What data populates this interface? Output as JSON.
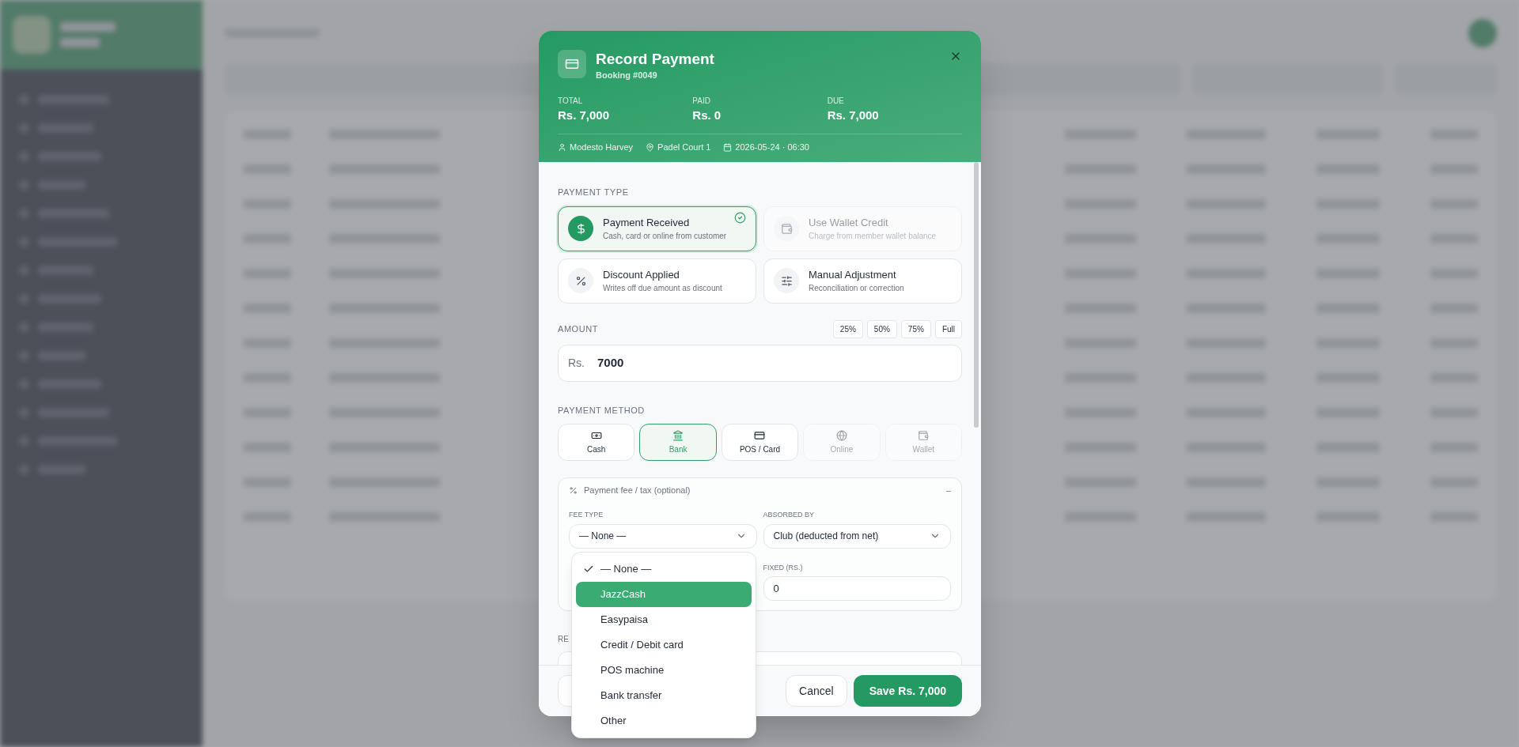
{
  "modal": {
    "title": "Record Payment",
    "subtitle": "Booking #0049",
    "summary": [
      {
        "label": "TOTAL",
        "value": "Rs. 7,000"
      },
      {
        "label": "PAID",
        "value": "Rs. 0"
      },
      {
        "label": "DUE",
        "value": "Rs. 7,000"
      }
    ],
    "meta": [
      {
        "kind": "person",
        "text": "Modesto Harvey"
      },
      {
        "kind": "location",
        "text": "Padel Court 1"
      },
      {
        "kind": "date",
        "text": "2026-05-24 · 06:30"
      }
    ]
  },
  "payment_type": {
    "label": "PAYMENT TYPE",
    "options": [
      {
        "kind": "received",
        "title": "Payment Received",
        "description": "Cash, card or online from customer",
        "selected": true,
        "disabled": false
      },
      {
        "kind": "wallet",
        "title": "Use Wallet Credit",
        "description": "Charge from member wallet balance",
        "selected": false,
        "disabled": true
      },
      {
        "kind": "discount",
        "title": "Discount Applied",
        "description": "Writes off due amount as discount",
        "selected": false,
        "disabled": false
      },
      {
        "kind": "adjustment",
        "title": "Manual Adjustment",
        "description": "Reconciliation or correction",
        "selected": false,
        "disabled": false
      }
    ]
  },
  "amount": {
    "label": "AMOUNT",
    "quick": [
      "25%",
      "50%",
      "75%",
      "Full"
    ],
    "currency": "Rs.",
    "value": "7000"
  },
  "payment_method": {
    "label": "PAYMENT METHOD",
    "options": [
      {
        "kind": "cash",
        "label": "Cash",
        "selected": false,
        "disabled": false
      },
      {
        "kind": "bank",
        "label": "Bank",
        "selected": true,
        "disabled": false
      },
      {
        "kind": "card",
        "label": "POS / Card",
        "selected": false,
        "disabled": false
      },
      {
        "kind": "online",
        "label": "Online",
        "selected": false,
        "disabled": true
      },
      {
        "kind": "wallet",
        "label": "Wallet",
        "selected": false,
        "disabled": true
      }
    ]
  },
  "fee": {
    "title": "Payment fee / tax (optional)",
    "toggle": "–",
    "fee_type": {
      "label": "FEE TYPE",
      "value": "— None —"
    },
    "absorbed_by": {
      "label": "ABSORBED BY",
      "value": "Club (deducted from net)"
    },
    "fixed": {
      "label": "FIXED (RS.)",
      "value": "0"
    }
  },
  "fee_type_menu": {
    "options": [
      {
        "label": "— None —",
        "checked": true,
        "selected": false
      },
      {
        "label": "JazzCash",
        "checked": false,
        "selected": true
      },
      {
        "label": "Easypaisa",
        "checked": false,
        "selected": false
      },
      {
        "label": "Credit / Debit card",
        "checked": false,
        "selected": false
      },
      {
        "label": "POS machine",
        "checked": false,
        "selected": false
      },
      {
        "label": "Bank transfer",
        "checked": false,
        "selected": false
      },
      {
        "label": "Other",
        "checked": false,
        "selected": false
      }
    ]
  },
  "remark_label": "RE",
  "footer": {
    "cancel": "Cancel",
    "save": "Save Rs. 7,000"
  }
}
